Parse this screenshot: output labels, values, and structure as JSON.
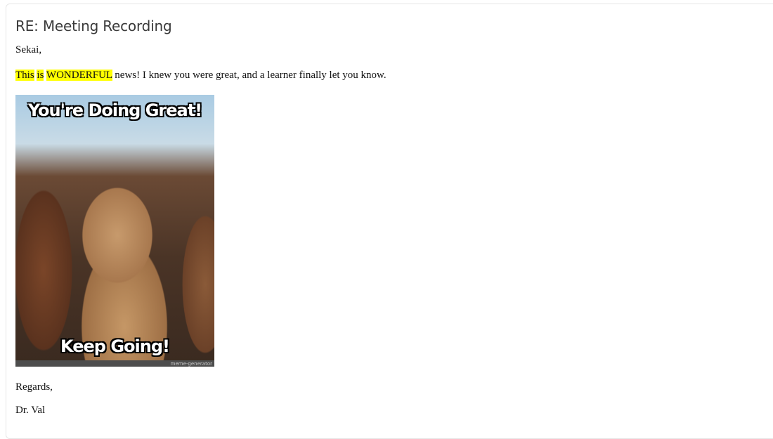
{
  "email": {
    "subject": "RE: Meeting Recording",
    "greeting": "Sekai,",
    "body": {
      "highlighted": [
        "This",
        "is",
        "WONDERFUL"
      ],
      "rest": " news! I knew you were great, and a learner finally let you know."
    },
    "image": {
      "top_text": "You're Doing Great!",
      "bottom_text": "Keep Going!",
      "watermark": "meme-generator"
    },
    "closing": "Regards,",
    "signature": "Dr. Val"
  },
  "colors": {
    "highlight": "#ffff00"
  }
}
